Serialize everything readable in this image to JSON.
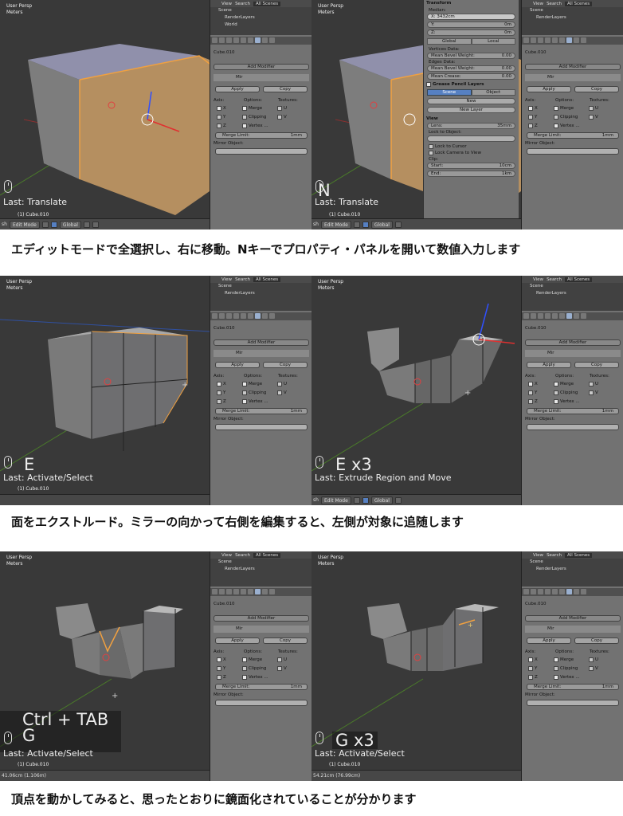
{
  "captions": [
    "エディットモードで全選択し、右に移動。Nキーでプロパティ・パネルを開いて数値入力します",
    "面をエクストルード。ミラーの向かって右側を編集すると、左側が対象に追随します",
    "頂点を動かしてみると、思ったとおりに鏡面化されていることが分かります"
  ],
  "panels": [
    {
      "view_name": "User Persp",
      "units": "Meters",
      "keys": "",
      "last_op": "Last: Translate",
      "object_label": "(1) Cube.010",
      "footer": "header",
      "show_n_panel": false
    },
    {
      "view_name": "User Persp",
      "units": "Meters",
      "keys": "N",
      "last_op": "Last: Translate",
      "object_label": "(1) Cube.010",
      "footer": "header",
      "show_n_panel": true
    },
    {
      "view_name": "User Persp",
      "units": "Meters",
      "keys": "E",
      "last_op": "Last: Activate/Select",
      "object_label": "(1) Cube.010",
      "footer": "status",
      "show_n_panel": false
    },
    {
      "view_name": "User Persp",
      "units": "Meters",
      "keys": "E x3",
      "last_op": "Last: Extrude Region and Move",
      "object_label": "",
      "footer": "header",
      "show_n_panel": false
    },
    {
      "view_name": "User Persp",
      "units": "Meters",
      "keys": "Ctrl + TAB\nG",
      "last_op": "Last: Activate/Select",
      "object_label": "(1) Cube.010",
      "footer": "status",
      "status_text": "41.06cm (1.106m)",
      "show_n_panel": false
    },
    {
      "view_name": "User Persp",
      "units": "Meters",
      "keys": "G x3",
      "last_op": "Last: Activate/Select",
      "object_label": "(1) Cube.010",
      "footer": "status",
      "status_text": "54.21cm (76.99cm)",
      "show_n_panel": false
    }
  ],
  "header_bar": {
    "mode": "Edit Mode",
    "orientation": "Global",
    "mode_prefix": "sh"
  },
  "outliner": {
    "tabs": [
      "View",
      "Search",
      "All Scenes"
    ],
    "items": [
      "Scene",
      "RenderLayers",
      "World"
    ]
  },
  "properties": {
    "object_name": "Cube.010",
    "add_modifier": "Add Modifier",
    "modifier_name": "Mir",
    "apply": "Apply",
    "copy": "Copy",
    "axis_label": "Axis:",
    "options_label": "Options:",
    "textures_label": "Textures:",
    "axes": [
      "X",
      "Y",
      "Z"
    ],
    "options": [
      "Merge",
      "Clipping",
      "Vertex ..."
    ],
    "textures": [
      "U",
      "V"
    ],
    "merge_limit_label": "Merge Limit:",
    "merge_limit_value": "1mm",
    "mirror_object_label": "Mirror Object:"
  },
  "n_panel": {
    "transform": "Transform",
    "median": "Median:",
    "x_value": "X: 3432cm",
    "y_label": "Y:",
    "y_value": "0m",
    "z_label": "Z:",
    "z_value": "0m",
    "global": "Global",
    "local": "Local",
    "vertices_data": "Vertices Data:",
    "mean_bevel_weight": "Mean Bevel Weight:",
    "mbw_value": "0.00",
    "edges_data": "Edges Data:",
    "mean_bevel_weight_2": "Mean Bevel Weight:",
    "mbw2_value": "0.00",
    "mean_crease": "Mean Crease:",
    "mc_value": "0.00",
    "grease_pencil": "Grease Pencil Layers",
    "scene": "Scene",
    "object": "Object",
    "new": "New",
    "new_layer": "New Layer",
    "view": "View",
    "lens": "Lens:",
    "lens_value": "35mm",
    "lock_to_object": "Lock to Object:",
    "lock_to_cursor": "Lock to Cursor",
    "lock_camera_to_view": "Lock Camera to View",
    "clip": "Clip:",
    "start": "Start:",
    "start_value": "10cm",
    "end": "End:",
    "end_value": "1km"
  },
  "colors": {
    "viewport": "#393939",
    "selection": "#e8a040",
    "panel": "#727272",
    "accent": "#5680c2"
  }
}
